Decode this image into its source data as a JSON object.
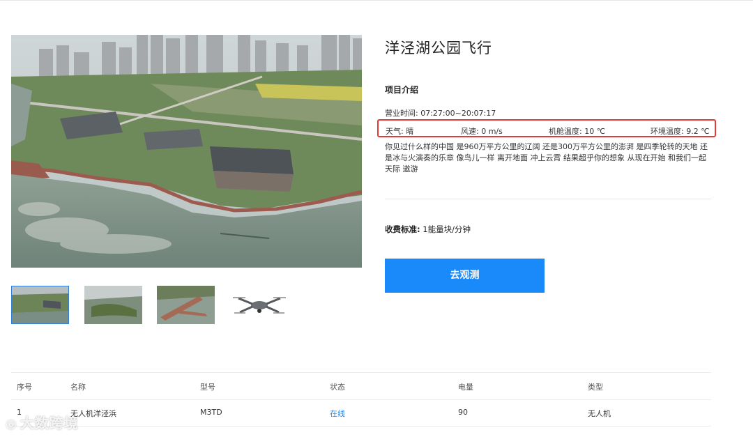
{
  "park": {
    "title": "洋泾湖公园飞行",
    "section_title": "项目介绍",
    "hours_label": "营业时间:",
    "hours_value": "07:27:00~20:07:17",
    "weather": {
      "weather_label": "天气:",
      "weather_value": "晴",
      "wind_label": "风速:",
      "wind_value": "0 m/s",
      "cabin_label": "机舱温度:",
      "cabin_value": "10 ℃",
      "env_label": "环境温度:",
      "env_value": "9.2 ℃",
      "highlight_color": "#e53935"
    },
    "description": "你见过什么样的中国 是960万平方公里的辽阔 还是300万平方公里的澎湃 是四季轮转的天地 还是冰与火演奏的乐章 像鸟儿一样 离开地面 冲上云霄 结果超乎你的想象 从现在开始 和我们一起 天际 遨游",
    "fee_label": "收费标准:",
    "fee_value": "1能量块/分钟",
    "action_button": "去观测",
    "accent_color": "#1a89fa"
  },
  "gallery": {
    "thumbnails": [
      "aerial-park-photo",
      "aerial-island-photo",
      "aerial-pier-photo",
      "drone-photo"
    ],
    "selected": 0
  },
  "table": {
    "headers": [
      "序号",
      "名称",
      "型号",
      "状态",
      "电量",
      "类型"
    ],
    "rows": [
      [
        "1",
        "无人机洋泾浜",
        "M3TD",
        "在线",
        "90",
        "无人机"
      ]
    ]
  },
  "watermark": {
    "icon": "weibo-like-icon",
    "text": "大数跨境"
  }
}
